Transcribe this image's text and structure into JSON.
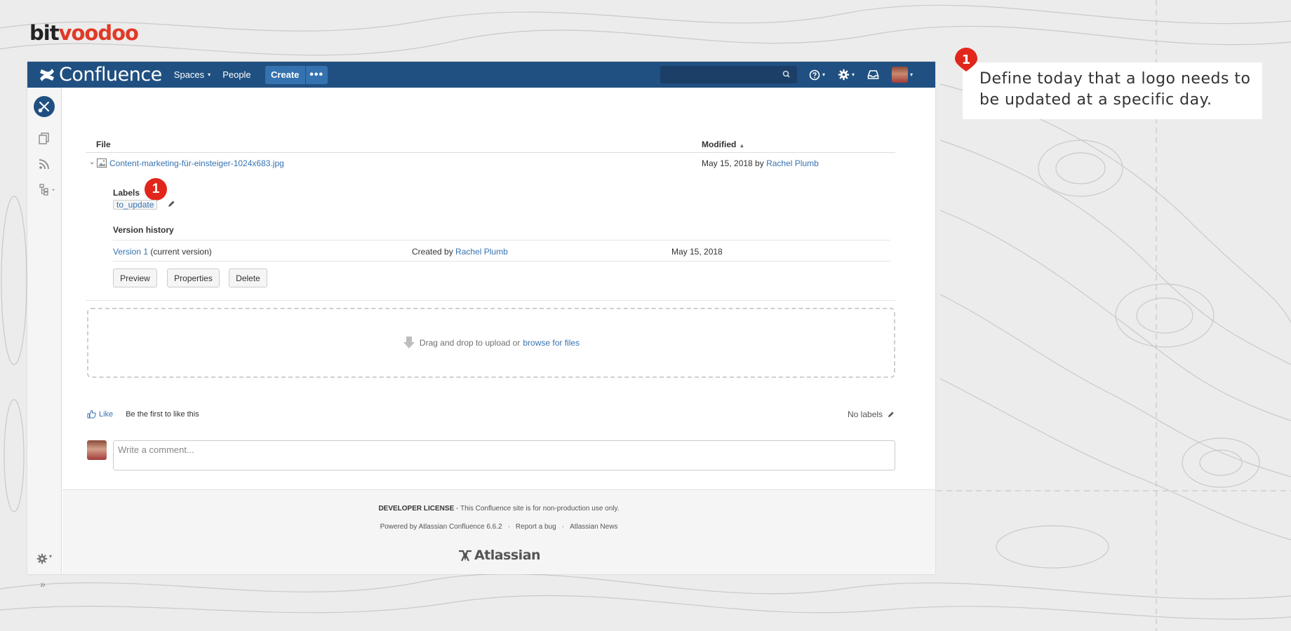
{
  "brand": {
    "part1": "bit",
    "part2": "voodoo"
  },
  "topbar": {
    "app_name": "Confluence",
    "nav": [
      {
        "label": "Spaces",
        "caret": "▾"
      },
      {
        "label": "People"
      }
    ],
    "create_label": "Create",
    "more_label": "•••",
    "search_placeholder": ""
  },
  "table": {
    "col_file": "File",
    "col_modified": "Modified",
    "sort_indicator": "▴",
    "file": {
      "name": "Content-marketing-für-einsteiger-1024x683.jpg",
      "modified_date": "May 15, 2018 by",
      "modified_by": "Rachel Plumb"
    }
  },
  "details": {
    "labels_title": "Labels",
    "label_chip": "to_update",
    "version_history_title": "Version history",
    "version_link": "Version 1",
    "version_note": "(current version)",
    "created_by_prefix": "Created by",
    "created_by": "Rachel Plumb",
    "version_date": "May 15, 2018",
    "buttons": {
      "preview": "Preview",
      "properties": "Properties",
      "delete": "Delete"
    }
  },
  "dropzone": {
    "text": "Drag and drop to upload or",
    "browse": "browse for files"
  },
  "social": {
    "like": "Like",
    "like_text": "Be the first to like this",
    "no_labels": "No labels"
  },
  "comment": {
    "placeholder": "Write a comment..."
  },
  "footer": {
    "license_bold": "DEVELOPER LICENSE",
    "license_text": " - This Confluence site is for non-production use only.",
    "powered": "Powered by Atlassian Confluence 6.6.2",
    "report": "Report a bug",
    "news": "Atlassian News",
    "sep": "·",
    "atlassian": "Atlassian"
  },
  "annotation": {
    "number": "1",
    "text_line1": "Define today that a logo needs to",
    "text_line2": "be updated at a specific day."
  },
  "colors": {
    "header": "#205081",
    "link": "#3572b0",
    "annotation": "#e1261c",
    "brand_accent": "#e03a26"
  }
}
